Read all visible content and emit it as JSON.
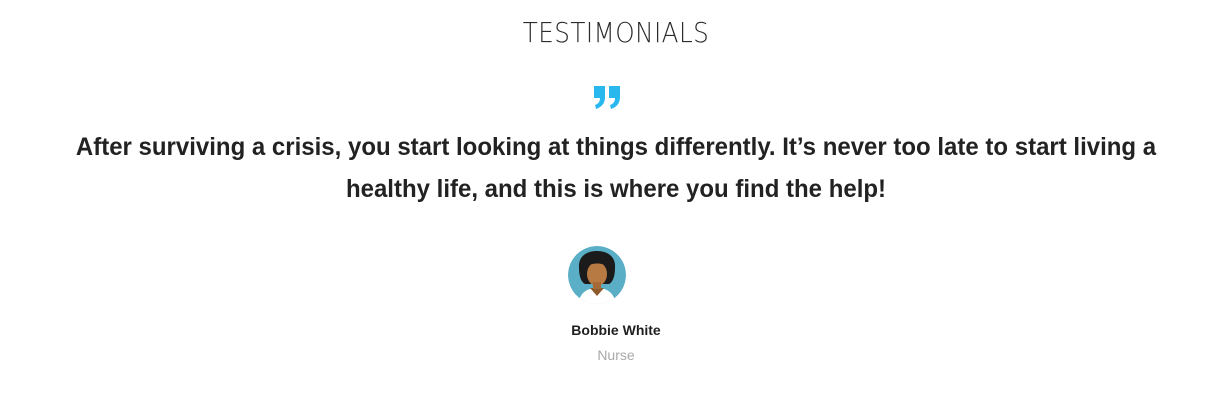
{
  "section": {
    "title": "TESTIMONIALS"
  },
  "testimonial": {
    "quote_icon": "quote-icon",
    "quote_color": "#29b8ee",
    "text": "After surviving a crisis, you start looking at things differently. It’s never too late to start living a healthy life, and this is where you find the help!",
    "author": {
      "avatar_icon": "avatar",
      "name": "Bobbie White",
      "role": "Nurse"
    }
  }
}
